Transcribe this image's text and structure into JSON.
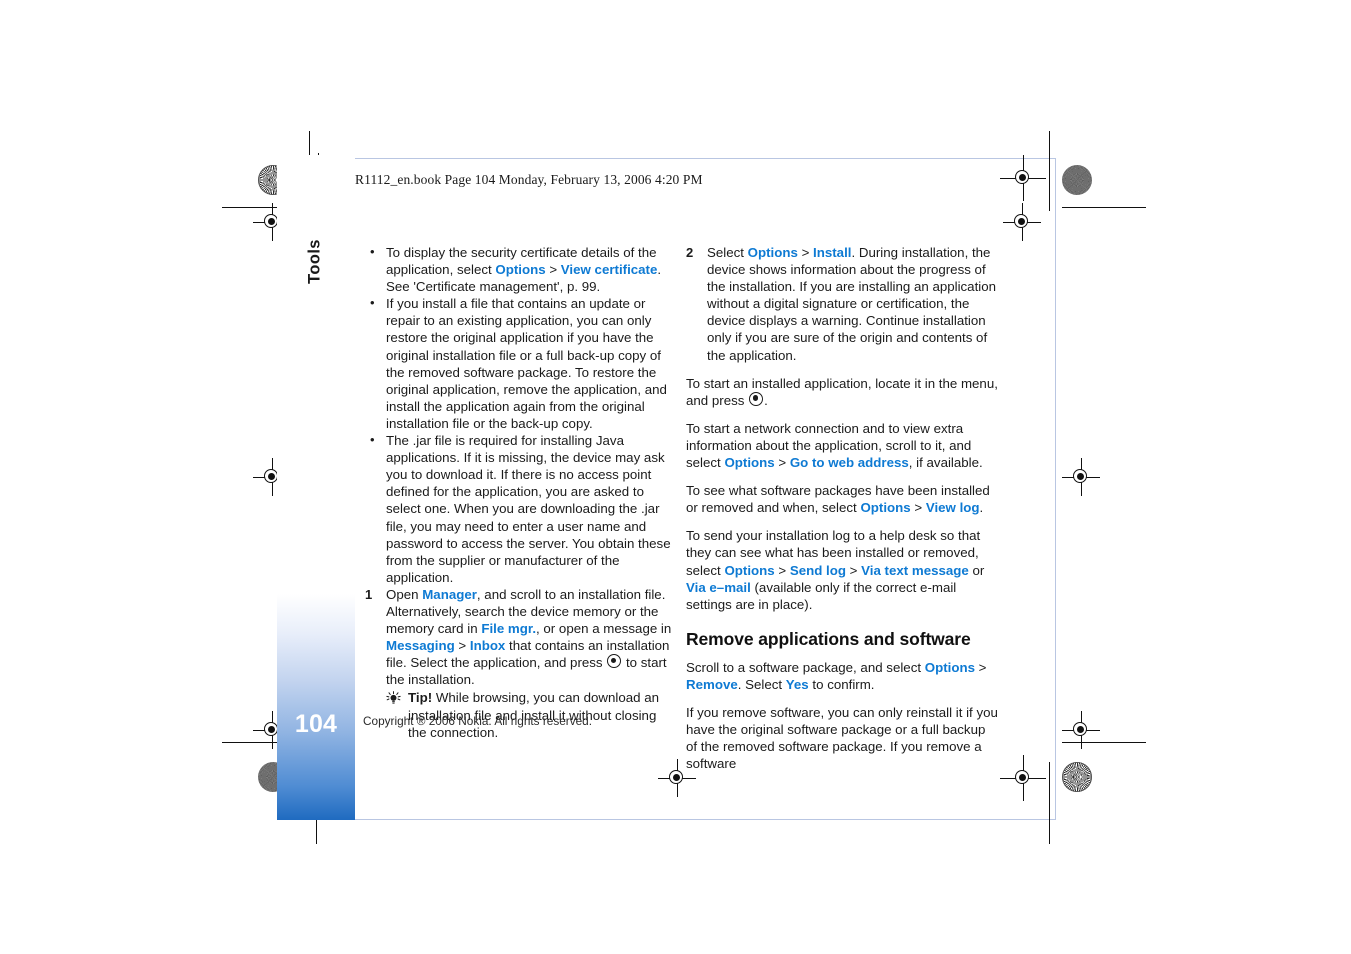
{
  "document": {
    "header_line": "R1112_en.book  Page 104  Monday, February 13, 2006  4:20 PM",
    "page_number": "104",
    "chapter_tab": "Tools",
    "copyright": "Copyright ® 2006 Nokia. All rights reserved.",
    "accent_link_color": "#0e7ad3",
    "tab_gradient_bottom_color": "#1f6bc0"
  },
  "left_column": {
    "bullets": [
      {
        "segments": [
          {
            "t": "To display the security certificate details of the application, select ",
            "style": "plain"
          },
          {
            "t": "Options",
            "style": "link"
          },
          {
            "t": " > ",
            "style": "plain"
          },
          {
            "t": "View certificate",
            "style": "link"
          },
          {
            "t": ". See 'Certificate management', p. 99.",
            "style": "plain"
          }
        ]
      },
      {
        "segments": [
          {
            "t": "If you install a file that contains an update or repair to an existing application, you can only restore the original application if you have the original installation file or a full back-up copy of the removed software package. To restore the original application, remove the application, and install the application again from the original installation file or the back-up copy.",
            "style": "plain"
          }
        ]
      },
      {
        "segments": [
          {
            "t": "The .jar file is required for installing Java applications. If it is missing, the device may ask you to download it. If there is no access point defined for the application, you are asked to select one. When you are downloading the .jar file, you may need to enter a user name and password to access the server. You obtain these from the supplier or manufacturer of the application.",
            "style": "plain"
          }
        ]
      }
    ],
    "step_1": {
      "number": "1",
      "segments": [
        {
          "t": "Open ",
          "style": "plain"
        },
        {
          "t": "Manager",
          "style": "link"
        },
        {
          "t": ", and scroll to an installation file. Alternatively, search the device memory or the memory card in ",
          "style": "plain"
        },
        {
          "t": "File mgr.",
          "style": "link"
        },
        {
          "t": ", or open a message in ",
          "style": "plain"
        },
        {
          "t": "Messaging",
          "style": "link"
        },
        {
          "t": " > ",
          "style": "plain"
        },
        {
          "t": "Inbox",
          "style": "link"
        },
        {
          "t": " that contains an installation file. Select the application, and press ",
          "style": "plain"
        },
        {
          "t": "◉",
          "style": "scrollkey"
        },
        {
          "t": " to start the installation.",
          "style": "plain"
        }
      ]
    },
    "tip": {
      "label": "Tip!",
      "text": " While browsing, you can download an installation file and install it without closing the connection."
    }
  },
  "right_column": {
    "step_2": {
      "number": "2",
      "segments": [
        {
          "t": "Select ",
          "style": "plain"
        },
        {
          "t": "Options",
          "style": "link"
        },
        {
          "t": " > ",
          "style": "plain"
        },
        {
          "t": "Install",
          "style": "link"
        },
        {
          "t": ". During installation, the device shows information about the progress of the installation. If you are installing an application without a digital signature or certification, the device displays a warning. Continue installation only if you are sure of the origin and contents of the application.",
          "style": "plain"
        }
      ]
    },
    "paragraphs": [
      {
        "segments": [
          {
            "t": "To start an installed application, locate it in the menu, and press ",
            "style": "plain"
          },
          {
            "t": "◉",
            "style": "scrollkey"
          },
          {
            "t": ".",
            "style": "plain"
          }
        ]
      },
      {
        "segments": [
          {
            "t": "To start a network connection and to view extra information about the application, scroll to it, and select ",
            "style": "plain"
          },
          {
            "t": "Options",
            "style": "link"
          },
          {
            "t": " > ",
            "style": "plain"
          },
          {
            "t": "Go to web address",
            "style": "link"
          },
          {
            "t": ", if available.",
            "style": "plain"
          }
        ]
      },
      {
        "segments": [
          {
            "t": "To see what software packages have been installed or removed and when, select ",
            "style": "plain"
          },
          {
            "t": "Options",
            "style": "link"
          },
          {
            "t": " > ",
            "style": "plain"
          },
          {
            "t": "View log",
            "style": "link"
          },
          {
            "t": ".",
            "style": "plain"
          }
        ]
      },
      {
        "segments": [
          {
            "t": "To send your installation log to a help desk so that they can see what has been installed or removed, select ",
            "style": "plain"
          },
          {
            "t": "Options",
            "style": "link"
          },
          {
            "t": " > ",
            "style": "plain"
          },
          {
            "t": "Send log",
            "style": "link"
          },
          {
            "t": " > ",
            "style": "plain"
          },
          {
            "t": "Via text message",
            "style": "link"
          },
          {
            "t": " or ",
            "style": "plain"
          },
          {
            "t": "Via e–mail",
            "style": "link"
          },
          {
            "t": " (available only if the correct e-mail settings are in place).",
            "style": "plain"
          }
        ]
      }
    ],
    "section_heading": "Remove applications and software",
    "section_paragraphs": [
      {
        "segments": [
          {
            "t": "Scroll to a software package, and select ",
            "style": "plain"
          },
          {
            "t": "Options",
            "style": "link"
          },
          {
            "t": " > ",
            "style": "plain"
          },
          {
            "t": "Remove",
            "style": "link"
          },
          {
            "t": ". Select ",
            "style": "plain"
          },
          {
            "t": "Yes",
            "style": "link"
          },
          {
            "t": " to confirm.",
            "style": "plain"
          }
        ]
      },
      {
        "segments": [
          {
            "t": "If you remove software, you can only reinstall it if you have the original software package or a full backup of the removed software package. If you remove a software",
            "style": "plain"
          }
        ]
      }
    ]
  }
}
